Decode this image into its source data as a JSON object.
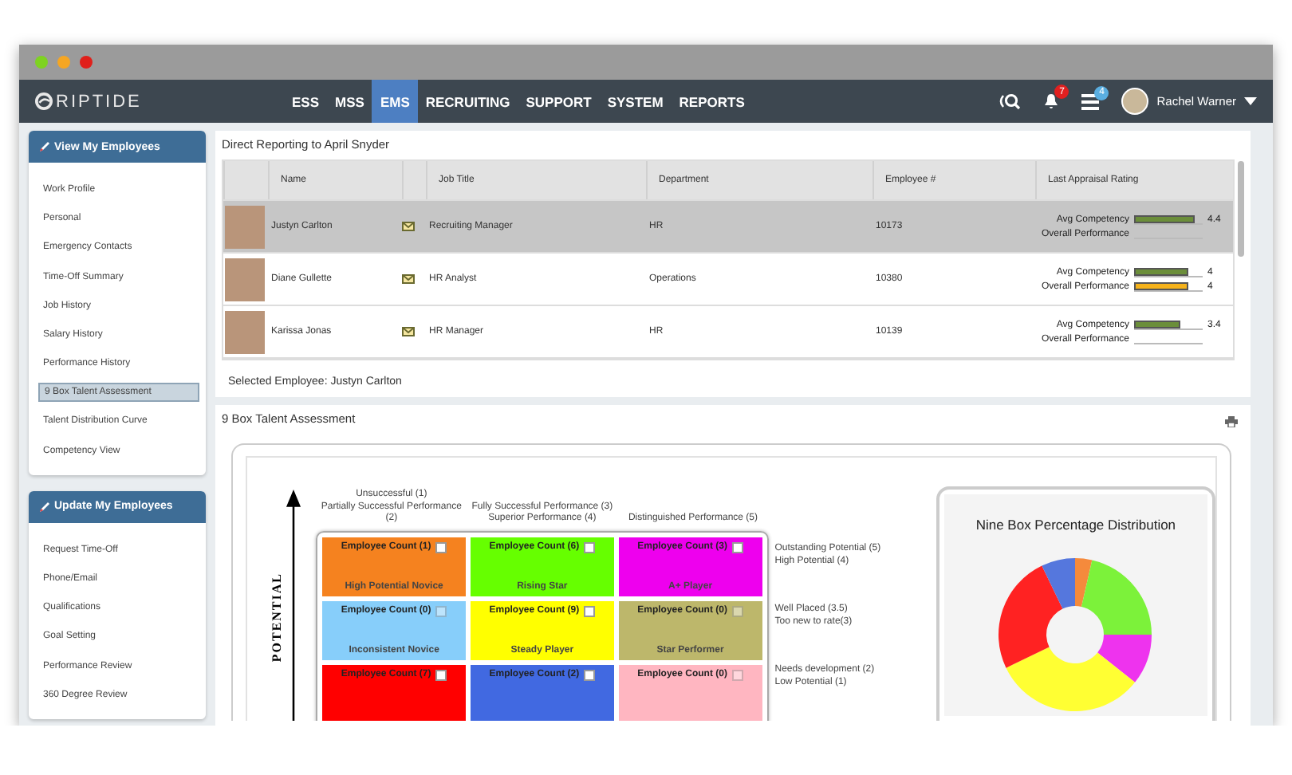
{
  "nav": {
    "logo": "RIPTIDE",
    "items": [
      {
        "label": "ESS",
        "selected": false
      },
      {
        "label": "MSS",
        "selected": false
      },
      {
        "label": "EMS",
        "selected": true
      },
      {
        "label": "RECRUITING",
        "selected": false
      },
      {
        "label": "SUPPORT",
        "selected": false
      },
      {
        "label": "SYSTEM",
        "selected": false
      },
      {
        "label": "REPORTS",
        "selected": false
      }
    ],
    "notifications_badge": "7",
    "tasks_badge": "4",
    "user": "Rachel Warner"
  },
  "sidebar": [
    {
      "title": "View My Employees",
      "items": [
        {
          "label": "Work Profile",
          "selected": false
        },
        {
          "label": "Personal",
          "selected": false
        },
        {
          "label": "Emergency Contacts",
          "selected": false
        },
        {
          "label": "Time-Off Summary",
          "selected": false
        },
        {
          "label": "Job History",
          "selected": false
        },
        {
          "label": "Salary History",
          "selected": false
        },
        {
          "label": "Performance History",
          "selected": false
        },
        {
          "label": "9 Box Talent Assessment",
          "selected": true
        },
        {
          "label": "Talent Distribution Curve",
          "selected": false
        },
        {
          "label": "Competency View",
          "selected": false
        }
      ]
    },
    {
      "title": "Update My Employees",
      "items": [
        {
          "label": "Request Time-Off",
          "selected": false
        },
        {
          "label": "Phone/Email",
          "selected": false
        },
        {
          "label": "Qualifications",
          "selected": false
        },
        {
          "label": "Goal Setting",
          "selected": false
        },
        {
          "label": "Performance Review",
          "selected": false
        },
        {
          "label": "360 Degree Review",
          "selected": false
        }
      ]
    }
  ],
  "reports": {
    "title": "Direct Reporting to April Snyder",
    "columns": [
      "Name",
      "Job Title",
      "Department",
      "Employee #",
      "Last Appraisal Rating"
    ],
    "rows": [
      {
        "name": "Justyn Carlton",
        "job_title": "Recruiting Manager",
        "department": "HR",
        "employee_no": "10173",
        "selected": true,
        "ratings": [
          {
            "label": "Avg Competency",
            "level": 0.88,
            "reading": "4.4"
          },
          {
            "label": "Overall Performance"
          }
        ]
      },
      {
        "name": "Diane Gullette",
        "job_title": "HR Analyst",
        "department": "Operations",
        "employee_no": "10380",
        "selected": false,
        "ratings": [
          {
            "label": "Avg Competency",
            "level": 0.8,
            "reading": "4"
          },
          {
            "label": "Overall Performance",
            "level": 0.8,
            "reading": "4"
          }
        ]
      },
      {
        "name": "Karissa Jonas",
        "job_title": "HR Manager",
        "department": "HR",
        "employee_no": "10139",
        "selected": false,
        "ratings": [
          {
            "label": "Avg Competency",
            "level": 0.68,
            "reading": "3.4"
          },
          {
            "label": "Overall Performance"
          }
        ]
      }
    ],
    "selected_text": "Selected Employee: Justyn Carlton"
  },
  "nine_box": {
    "title": "9 Box Talent Assessment",
    "axis_label": "POTENTIAL",
    "columns": [
      {
        "lines": [
          "Unsuccessful (1)",
          "Partially Successful Performance (2)"
        ]
      },
      {
        "lines": [
          "Fully Successful Performance (3)",
          "Superior Performance (4)"
        ]
      },
      {
        "lines": [
          "Distinguished Performance (5)"
        ]
      }
    ],
    "rows": [
      {
        "lines": [
          "Outstanding Potential (5)",
          "High Potential (4)"
        ]
      },
      {
        "lines": [
          "Well Placed (3.5)",
          "Too new to rate(3)"
        ]
      },
      {
        "lines": [
          "Needs development (2)",
          "Low Potential (1)"
        ]
      }
    ],
    "cells": [
      {
        "count": "Employee Count (1)",
        "name": "High Potential Novice",
        "color": "#f5821f",
        "disabled": false
      },
      {
        "count": "Employee Count (6)",
        "name": "Rising Star",
        "color": "#66ff00",
        "disabled": false
      },
      {
        "count": "Employee Count (3)",
        "name": "A+ Player",
        "color": "#ee00ee",
        "disabled": false
      },
      {
        "count": "Employee Count (0)",
        "name": "Inconsistent Novice",
        "color": "#87cefa",
        "disabled": true
      },
      {
        "count": "Employee Count (9)",
        "name": "Steady Player",
        "color": "#ffff00",
        "disabled": false
      },
      {
        "count": "Employee Count (0)",
        "name": "Star Performer",
        "color": "#bdb76b",
        "disabled": true
      },
      {
        "count": "Employee Count (7)",
        "color": "#ff0000",
        "disabled": false
      },
      {
        "count": "Employee Count (2)",
        "color": "#4169e1",
        "disabled": false
      },
      {
        "count": "Employee Count (0)",
        "color": "#ffb6c1",
        "disabled": true
      }
    ],
    "chart_title": "Nine Box Percentage Distribution"
  }
}
